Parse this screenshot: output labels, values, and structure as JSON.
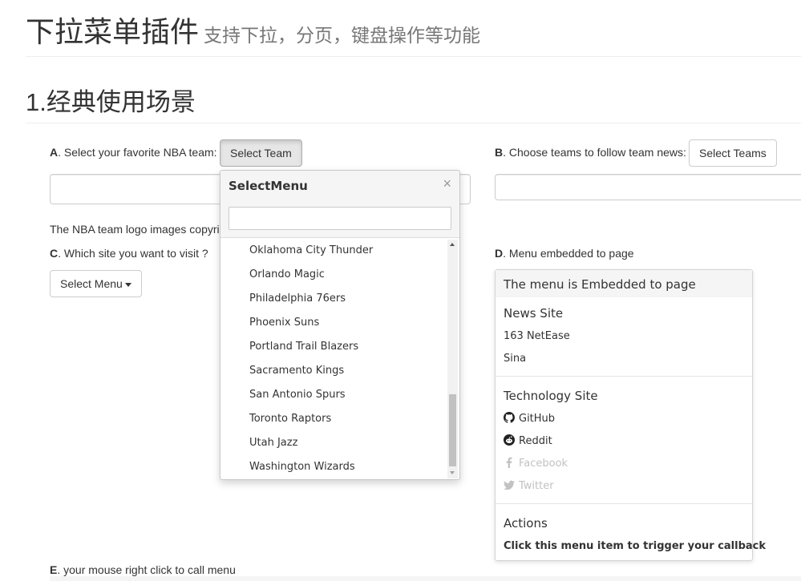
{
  "header": {
    "title": "下拉菜单插件",
    "subtitle": "支持下拉，分页，键盘操作等功能"
  },
  "section": {
    "title": "1.经典使用场景"
  },
  "demo_a": {
    "letter": "A",
    "label": ". Select your favorite NBA team:",
    "button_label": "Select Team",
    "note": "The NBA team logo images copyri"
  },
  "demo_b": {
    "letter": "B",
    "label": ". Choose teams to follow team news:",
    "button_label": "Select Teams"
  },
  "demo_c": {
    "letter": "C",
    "label": ". Which site you want to visit ?",
    "button_label": "Select Menu"
  },
  "demo_d": {
    "letter": "D",
    "label": ". Menu embedded to page"
  },
  "demo_e": {
    "letter": "E",
    "label": ". your mouse right click to call menu"
  },
  "select_menu": {
    "title": "SelectMenu",
    "close_glyph": "×",
    "search_value": "",
    "items": [
      "Oklahoma City Thunder",
      "Orlando Magic",
      "Philadelphia 76ers",
      "Phoenix Suns",
      "Portland Trail Blazers",
      "Sacramento Kings",
      "San Antonio Spurs",
      "Toronto Raptors",
      "Utah Jazz",
      "Washington Wizards"
    ],
    "scroll_position": 0.85
  },
  "embedded_menu": {
    "title": "The menu is Embedded to page",
    "groups": [
      {
        "title": "News Site",
        "items": [
          {
            "label": "163 NetEase",
            "icon": "",
            "disabled": false
          },
          {
            "label": "Sina",
            "icon": "",
            "disabled": false
          }
        ]
      },
      {
        "title": "Technology Site",
        "items": [
          {
            "label": "GitHub",
            "icon": "github-icon",
            "disabled": false
          },
          {
            "label": "Reddit",
            "icon": "reddit-icon",
            "disabled": false
          },
          {
            "label": "Facebook",
            "icon": "facebook-icon",
            "disabled": true
          },
          {
            "label": "Twitter",
            "icon": "twitter-icon",
            "disabled": true
          }
        ]
      },
      {
        "title": "Actions",
        "items": [
          {
            "label": "Click this menu item to trigger your callback",
            "icon": "",
            "disabled": false
          }
        ]
      }
    ]
  },
  "colors": {
    "text": "#333333",
    "muted": "#777777",
    "disabled": "#c2c2c2",
    "panel_header": "#f5f5f5",
    "border": "#cccccc"
  }
}
